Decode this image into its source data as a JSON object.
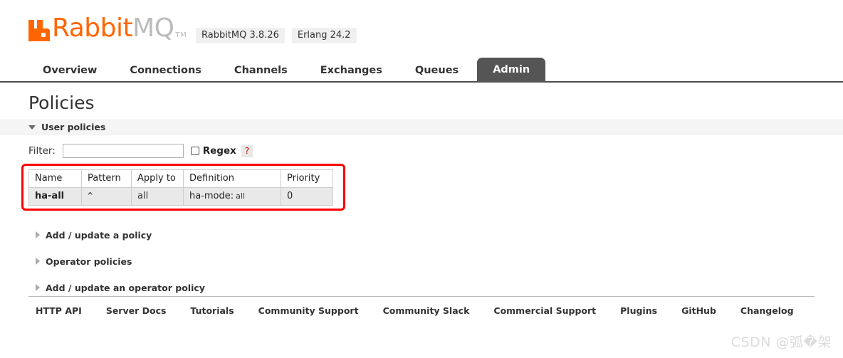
{
  "header": {
    "logo_rabbit": "Rabbit",
    "logo_mq": "MQ",
    "logo_tm": "TM",
    "rabbitmq_version": "RabbitMQ 3.8.26",
    "erlang_version": "Erlang 24.2",
    "accent_color": "#ff6600"
  },
  "nav": {
    "items": [
      {
        "label": "Overview",
        "active": false
      },
      {
        "label": "Connections",
        "active": false
      },
      {
        "label": "Channels",
        "active": false
      },
      {
        "label": "Exchanges",
        "active": false
      },
      {
        "label": "Queues",
        "active": false
      },
      {
        "label": "Admin",
        "active": true
      }
    ],
    "active_bg": "#555555"
  },
  "main": {
    "page_title": "Policies",
    "user_policies_section": {
      "title": "User policies",
      "expanded": true
    },
    "filter": {
      "label": "Filter:",
      "value": "",
      "placeholder": "",
      "regex_label": "Regex",
      "regex_checked": false,
      "help_label": "?"
    },
    "policies_table": {
      "columns": [
        "Name",
        "Pattern",
        "Apply to",
        "Definition",
        "Priority"
      ],
      "rows": [
        {
          "name": "ha-all",
          "pattern": "^",
          "apply_to": "all",
          "definition_key": "ha-mode:",
          "definition_value": "all",
          "priority": "0"
        }
      ],
      "annotation_color": "#ff0000"
    },
    "collapsed_sections": [
      {
        "title": "Add / update a policy",
        "expanded": false
      },
      {
        "title": "Operator policies",
        "expanded": false
      },
      {
        "title": "Add / update an operator policy",
        "expanded": false
      }
    ]
  },
  "footer": {
    "links": [
      "HTTP API",
      "Server Docs",
      "Tutorials",
      "Community Support",
      "Community Slack",
      "Commercial Support",
      "Plugins",
      "GitHub",
      "Changelog"
    ]
  },
  "watermark": {
    "text": "CSDN @弧�架"
  }
}
